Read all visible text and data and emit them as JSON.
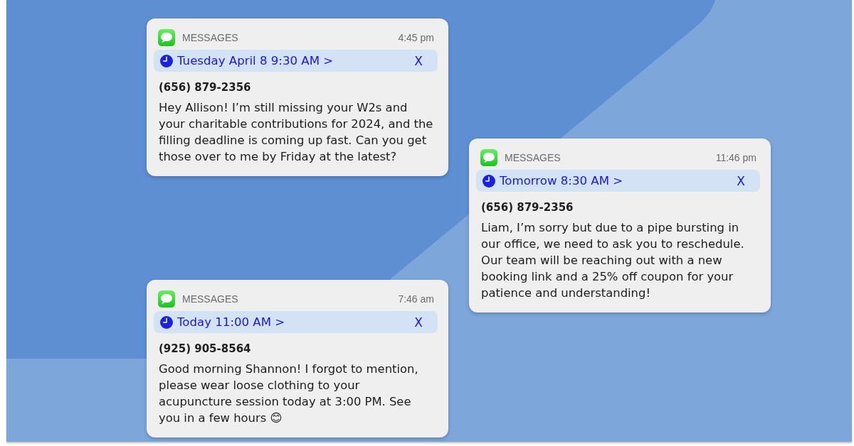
{
  "columns": [
    {
      "notifications": [
        {
          "app": "MESSAGES",
          "time": "4:45 pm",
          "schedule": {
            "label": "Tuesday April 8 9:30 AM >",
            "close": "X"
          },
          "sender": "(656) 879-2356",
          "message": "Hey Allison! I’m still missing your W2s and your charitable contributions for 2024, and the filling deadline is coming up fast. Can you get those over to me by Friday at the latest?"
        },
        {
          "app": "MESSAGES",
          "time": "7:46 am",
          "schedule": {
            "label": "Today 11:00 AM >",
            "close": "X"
          },
          "sender": "(925) 905-8564",
          "message": "Good morning Shannon! I forgot to mention, please wear loose clothing to your acupuncture session today at 3:00 PM. See you in a few hours 😊"
        }
      ]
    },
    {
      "notifications": [
        {
          "app": "MESSAGES",
          "time": "11:46 pm",
          "schedule": {
            "label": "Tomorrow 8:30 AM >",
            "close": "X"
          },
          "sender": "(656) 879-2356",
          "message": "Liam, I’m sorry but due to a pipe bursting in our office, we need to ask you to reschedule. Our team will be reaching out with a new booking link and a 25% off coupon for your patience and understanding!"
        }
      ]
    }
  ]
}
